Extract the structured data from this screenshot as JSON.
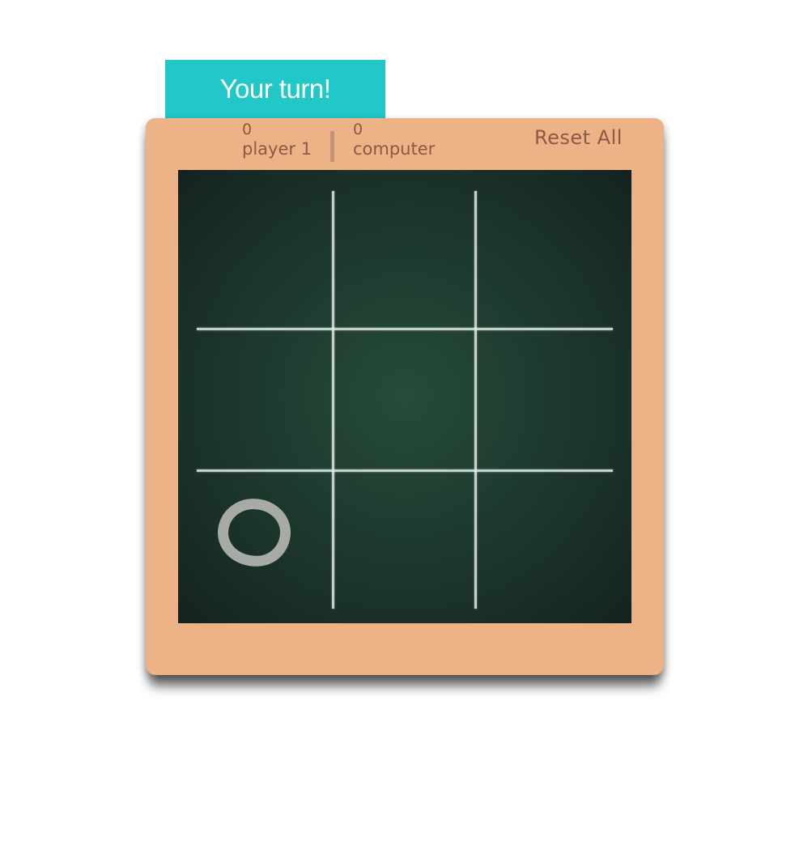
{
  "status": {
    "turn_message": "Your turn!"
  },
  "scoreboard": {
    "player": {
      "count": "0",
      "label": "player 1"
    },
    "computer": {
      "count": "0",
      "label": "computer"
    },
    "reset_label": "Reset All"
  },
  "board": {
    "cells": [
      "",
      "",
      "",
      "",
      "",
      "",
      "O",
      "",
      ""
    ]
  },
  "colors": {
    "banner": "#22c8c8",
    "frame": "#edb285",
    "chalkboard": "#1f3c30",
    "chalk": "#a8aaa6",
    "text": "#8a5a48"
  }
}
